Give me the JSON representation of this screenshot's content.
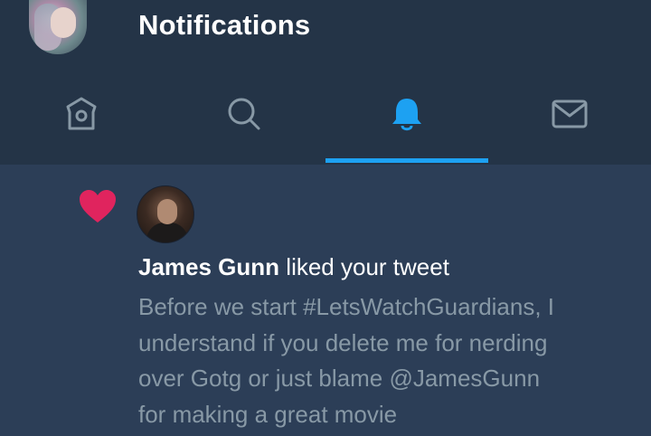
{
  "header": {
    "title": "Notifications"
  },
  "tabs": [
    {
      "name": "home",
      "icon": "home-icon",
      "active": false
    },
    {
      "name": "search",
      "icon": "search-icon",
      "active": false
    },
    {
      "name": "notifications",
      "icon": "bell-icon",
      "active": true
    },
    {
      "name": "messages",
      "icon": "mail-icon",
      "active": false
    }
  ],
  "colors": {
    "accent": "#1da1f2",
    "like": "#e0245e",
    "header_bg": "#243447",
    "body_bg": "#2c3e57",
    "secondary_text": "#8899a6"
  },
  "notification": {
    "icon": "heart-icon",
    "actor_name": "James Gunn",
    "action": " liked your tweet",
    "tweet_lines": [
      "Before we start #LetsWatchGuardians, I",
      "understand if you delete me for nerding",
      "over Gotg or just blame @JamesGunn",
      "for making a great movie"
    ]
  }
}
